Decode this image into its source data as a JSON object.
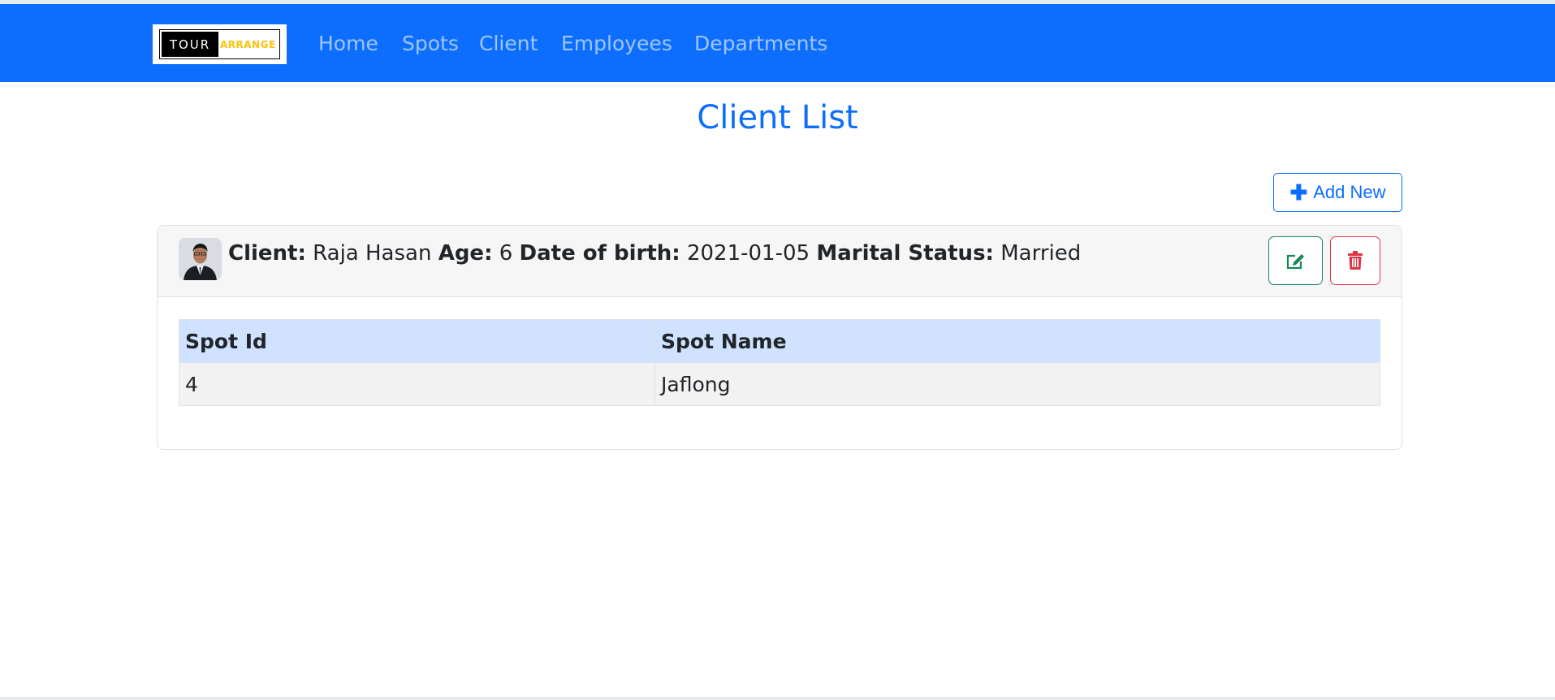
{
  "brand": {
    "logo_left": "TOUR",
    "logo_right": "ARRANGE",
    "logo_left_color": "#000000",
    "logo_right_color": "#ffc107"
  },
  "nav": {
    "items": [
      "Home",
      "Spots",
      "Client",
      "Employees",
      "Departments"
    ],
    "bg_color": "#0d6efd"
  },
  "page": {
    "title": "Client List"
  },
  "actions": {
    "add_new_label": "Add New",
    "add_icon": "plus-icon",
    "edit_icon": "edit-icon",
    "delete_icon": "trash-icon"
  },
  "client": {
    "client_label": "Client:",
    "name": "Raja Hasan",
    "age_label": "Age:",
    "age": "6",
    "dob_label": "Date of birth:",
    "dob": "2021-01-05",
    "marital_label": "Marital Status:",
    "marital_status": "Married"
  },
  "spots_table": {
    "headers": [
      "Spot Id",
      "Spot Name"
    ],
    "rows": [
      [
        "4",
        "Jaflong"
      ]
    ]
  }
}
